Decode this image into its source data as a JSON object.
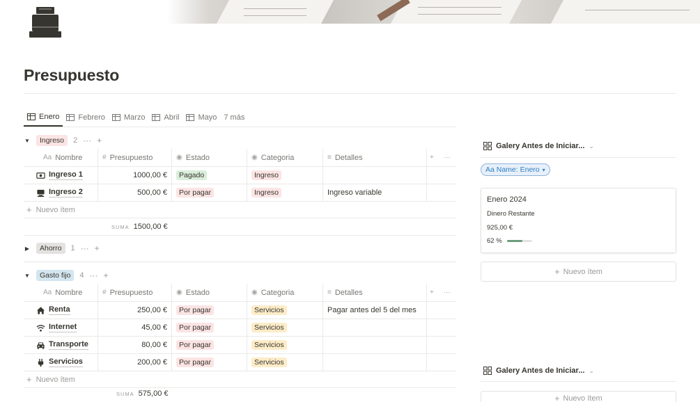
{
  "page": {
    "title": "Presupuesto",
    "icon": "cash-register-icon"
  },
  "tabs": [
    {
      "label": "Enero",
      "icon": "table-icon",
      "active": true
    },
    {
      "label": "Febrero",
      "icon": "table-icon"
    },
    {
      "label": "Marzo",
      "icon": "table-icon"
    },
    {
      "label": "Abril",
      "icon": "table-icon"
    },
    {
      "label": "Mayo",
      "icon": "table-icon"
    },
    {
      "label": "7 más"
    }
  ],
  "columns": {
    "nombre": "Nombre",
    "presupuesto": "Presupuesto",
    "estado": "Estado",
    "categoria": "Categoria",
    "detalles": "Detalles",
    "nombre_icon_text": "Aa"
  },
  "groups": {
    "ingreso": {
      "label": "Ingreso",
      "count": "2",
      "expanded": true,
      "rows": [
        {
          "icon": "money-icon",
          "name": "Ingreso 1",
          "presupuesto": "1000,00 €",
          "estado": "Pagado",
          "estado_color": "#dbeddb",
          "categoria": "Ingreso",
          "detalles": ""
        },
        {
          "icon": "computer-icon",
          "name": "Ingreso 2",
          "presupuesto": "500,00 €",
          "estado": "Por pagar",
          "estado_color": "#fbe4e4",
          "categoria": "Ingreso",
          "detalles": "Ingreso variable"
        }
      ],
      "new_item": "Nuevo ítem",
      "sum_label": "SUMA",
      "sum_value": "1500,00 €"
    },
    "ahorro": {
      "label": "Ahorro",
      "count": "1",
      "expanded": false
    },
    "gasto_fijo": {
      "label": "Gasto fijo",
      "count": "4",
      "expanded": true,
      "rows": [
        {
          "icon": "home-icon",
          "name": "Renta",
          "presupuesto": "250,00 €",
          "estado": "Por pagar",
          "categoria": "Servicios",
          "detalles": "Pagar antes del 5 del mes"
        },
        {
          "icon": "wifi-icon",
          "name": "Internet",
          "presupuesto": "45,00 €",
          "estado": "Por pagar",
          "categoria": "Servicios",
          "detalles": ""
        },
        {
          "icon": "car-icon",
          "name": "Transporte",
          "presupuesto": "80,00 €",
          "estado": "Por pagar",
          "categoria": "Servicios",
          "detalles": ""
        },
        {
          "icon": "plug-icon",
          "name": "Servicios",
          "presupuesto": "200,00 €",
          "estado": "Por pagar",
          "categoria": "Servicios",
          "detalles": ""
        }
      ],
      "new_item": "Nuevo ítem",
      "sum_label": "SUMA",
      "sum_value": "575,00 €"
    }
  },
  "gallery": {
    "title": "Galery Antes de Iniciar...",
    "filter": "Aa Name: Enero",
    "card": {
      "title": "Enero 2024",
      "label": "Dinero Restante",
      "value": "925,00 €",
      "percent": "62 %",
      "progress": 0.62
    },
    "new_item": "Nuevo ítem"
  },
  "gallery2": {
    "title": "Galery Antes de Iniciar...",
    "new_item": "Nuevo ítem"
  }
}
